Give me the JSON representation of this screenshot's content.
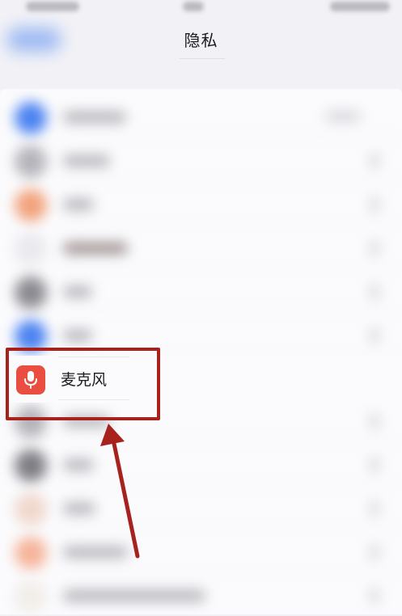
{
  "nav": {
    "title": "隐私"
  },
  "list": {
    "highlighted_item": {
      "label": "麦克风",
      "icon": "microphone-icon"
    }
  },
  "colors": {
    "mic_icon_bg": "#ea4e41",
    "annotation": "#a8221d"
  }
}
